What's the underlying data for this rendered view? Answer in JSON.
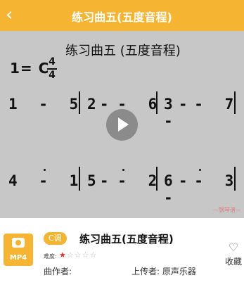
{
  "header": {
    "back_glyph": "‹",
    "title": "练习曲五(五度音程)"
  },
  "score": {
    "title": "练习曲五 (五度音程)",
    "key": "1= C",
    "time_top": "4",
    "time_bottom": "4",
    "row1": [
      "1 - 5 -",
      "2 - 6 -",
      "3 - 7 -"
    ],
    "row2": [
      "4 - 1 -",
      "5 - 2 -",
      "6 - 3 -"
    ],
    "watermark": "—钢琴谱—"
  },
  "info": {
    "format_label": "MP4",
    "key_tag": "C调",
    "song_title": "练习曲五(五度音程)",
    "difficulty_label": "难度:",
    "difficulty_rating": 1,
    "difficulty_max": 5,
    "composer": "曲作者:",
    "uploader": "上传者: 原声乐器",
    "favorite_label": "收藏",
    "favorite_glyph": "♡"
  },
  "colors": {
    "accent": "#f5b431",
    "star_on": "#e03030",
    "star_off": "#bbbbbb"
  },
  "icons": [
    "back-arrow-icon",
    "play-icon",
    "camera-icon",
    "star-icon",
    "heart-icon"
  ]
}
